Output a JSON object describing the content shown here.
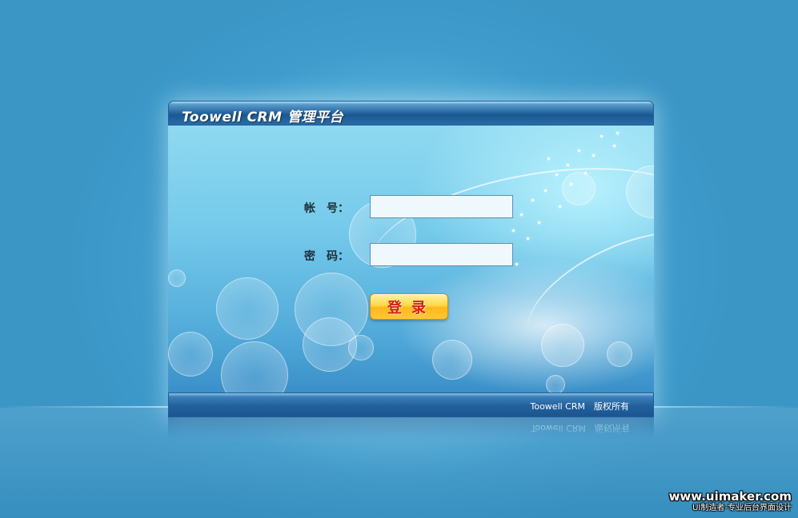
{
  "window": {
    "title": "Toowell CRM 管理平台"
  },
  "login_form": {
    "account_label": "帐　号：",
    "account_value": "",
    "password_label": "密　码：",
    "password_value": "",
    "submit_label": "登录"
  },
  "footer": {
    "copyright": "Toowell CRM　版权所有"
  },
  "watermark": {
    "url": "www.uimaker.com",
    "tagline": "UI制造者-专业后台界面设计"
  },
  "colors": {
    "background": "#4aa6d2",
    "title_bar": "#24649e",
    "button": "#ffc83a",
    "button_text": "#d0231b"
  }
}
